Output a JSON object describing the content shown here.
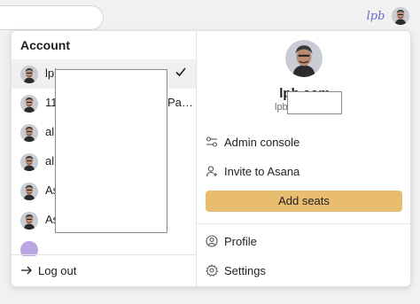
{
  "topbar": {
    "workspace_logo_text": "lpb"
  },
  "account_menu": {
    "section_title": "Account",
    "accounts": [
      {
        "name": "lpb",
        "selected": true
      },
      {
        "name": "11",
        "suffix": "Pa…",
        "selected": false
      },
      {
        "name": "al",
        "selected": false
      },
      {
        "name": "al",
        "selected": false
      },
      {
        "name": "As",
        "selected": false
      },
      {
        "name": "As",
        "selected": false
      }
    ],
    "logout_label": "Log out"
  },
  "profile": {
    "name": "lpb.com",
    "email": "lpb",
    "menu": {
      "admin_console": "Admin console",
      "invite": "Invite to Asana",
      "add_seats": "Add seats",
      "profile": "Profile",
      "settings": "Settings"
    }
  },
  "colors": {
    "add_seats_bg": "#e8bd70",
    "selected_row_bg": "#f0f0f1"
  },
  "icons": [
    "check-icon",
    "logout-arrow-icon",
    "admin-sliders-icon",
    "invite-user-icon",
    "profile-icon",
    "settings-gear-icon"
  ]
}
